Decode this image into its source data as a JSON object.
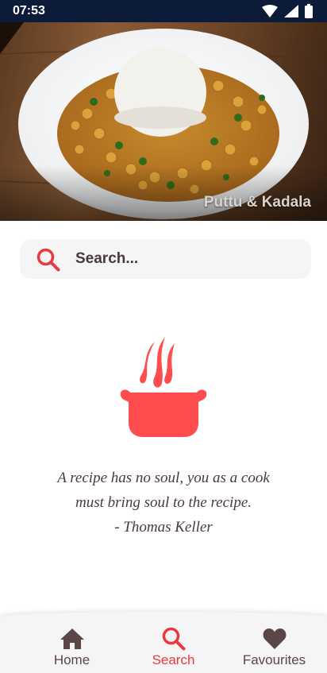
{
  "status_bar": {
    "time": "07:53"
  },
  "hero": {
    "caption": "Puttu & Kadala"
  },
  "search": {
    "placeholder": "Search..."
  },
  "quote": {
    "line1": "A recipe has no soul, you as a cook",
    "line2": "must bring soul to the recipe.",
    "author": "- Thomas Keller"
  },
  "bottom_nav": {
    "items": [
      {
        "label": "Home",
        "icon": "home-icon"
      },
      {
        "label": "Search",
        "icon": "search-icon",
        "active": true
      },
      {
        "label": "Favourites",
        "icon": "heart-icon"
      }
    ]
  },
  "colors": {
    "accent": "#e8393f",
    "pot": "#ff4d4f",
    "text": "#4a3a3a",
    "statusbar": "#0c1b3a"
  }
}
